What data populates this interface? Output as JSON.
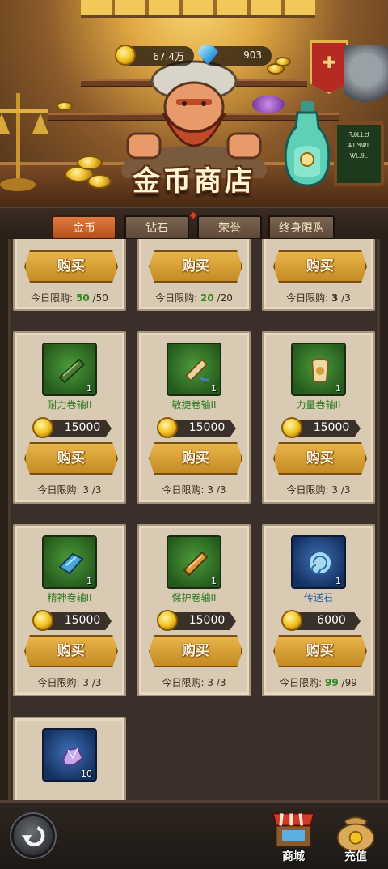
{
  "header": {
    "title": "金币商店",
    "gold_amount": "67.4万",
    "gem_amount": "903",
    "menu_board": [
      "ꟻᎯᏞᏞᏌ",
      "ᏔᏞᏕᏔᏞ",
      "ᏔᏞᎯᏞ"
    ]
  },
  "tabs": [
    {
      "label": "金币",
      "active": true
    },
    {
      "label": "钻石",
      "active": false
    },
    {
      "label": "荣誉",
      "active": false
    },
    {
      "label": "终身限购",
      "active": false
    }
  ],
  "shop": {
    "buy_label": "购买",
    "limit_label": "今日限购:",
    "partial_row": [
      {
        "remaining": "50",
        "total": "/50"
      },
      {
        "remaining": "20",
        "total": "/20"
      },
      {
        "remaining": "3",
        "total": "/3"
      }
    ],
    "items": [
      {
        "name": "耐力卷轴II",
        "qty": "1",
        "price": "15000",
        "remaining": "3",
        "total": "/3",
        "icon": "endurance-scroll-icon",
        "frame": "green"
      },
      {
        "name": "敏捷卷轴II",
        "qty": "1",
        "price": "15000",
        "remaining": "3",
        "total": "/3",
        "icon": "agility-scroll-icon",
        "frame": "green"
      },
      {
        "name": "力量卷轴II",
        "qty": "1",
        "price": "15000",
        "remaining": "3",
        "total": "/3",
        "icon": "strength-scroll-icon",
        "frame": "green"
      },
      {
        "name": "精神卷轴II",
        "qty": "1",
        "price": "15000",
        "remaining": "3",
        "total": "/3",
        "icon": "spirit-scroll-icon",
        "frame": "green"
      },
      {
        "name": "保护卷轴II",
        "qty": "1",
        "price": "15000",
        "remaining": "3",
        "total": "/3",
        "icon": "protection-scroll-icon",
        "frame": "green"
      },
      {
        "name": "传送石",
        "qty": "1",
        "price": "6000",
        "remaining": "99",
        "total": "/99",
        "icon": "teleport-stone-icon",
        "frame": "blue"
      }
    ],
    "last_item": {
      "qty": "10",
      "icon": "purple-ore-icon",
      "frame": "blue"
    }
  },
  "bottom_nav": {
    "shop_label": "商城",
    "recharge_label": "充值"
  },
  "colors": {
    "limit_remaining": "#2f8a24",
    "tab_active": "#d0662e",
    "buy_button": "#d9a03a"
  }
}
